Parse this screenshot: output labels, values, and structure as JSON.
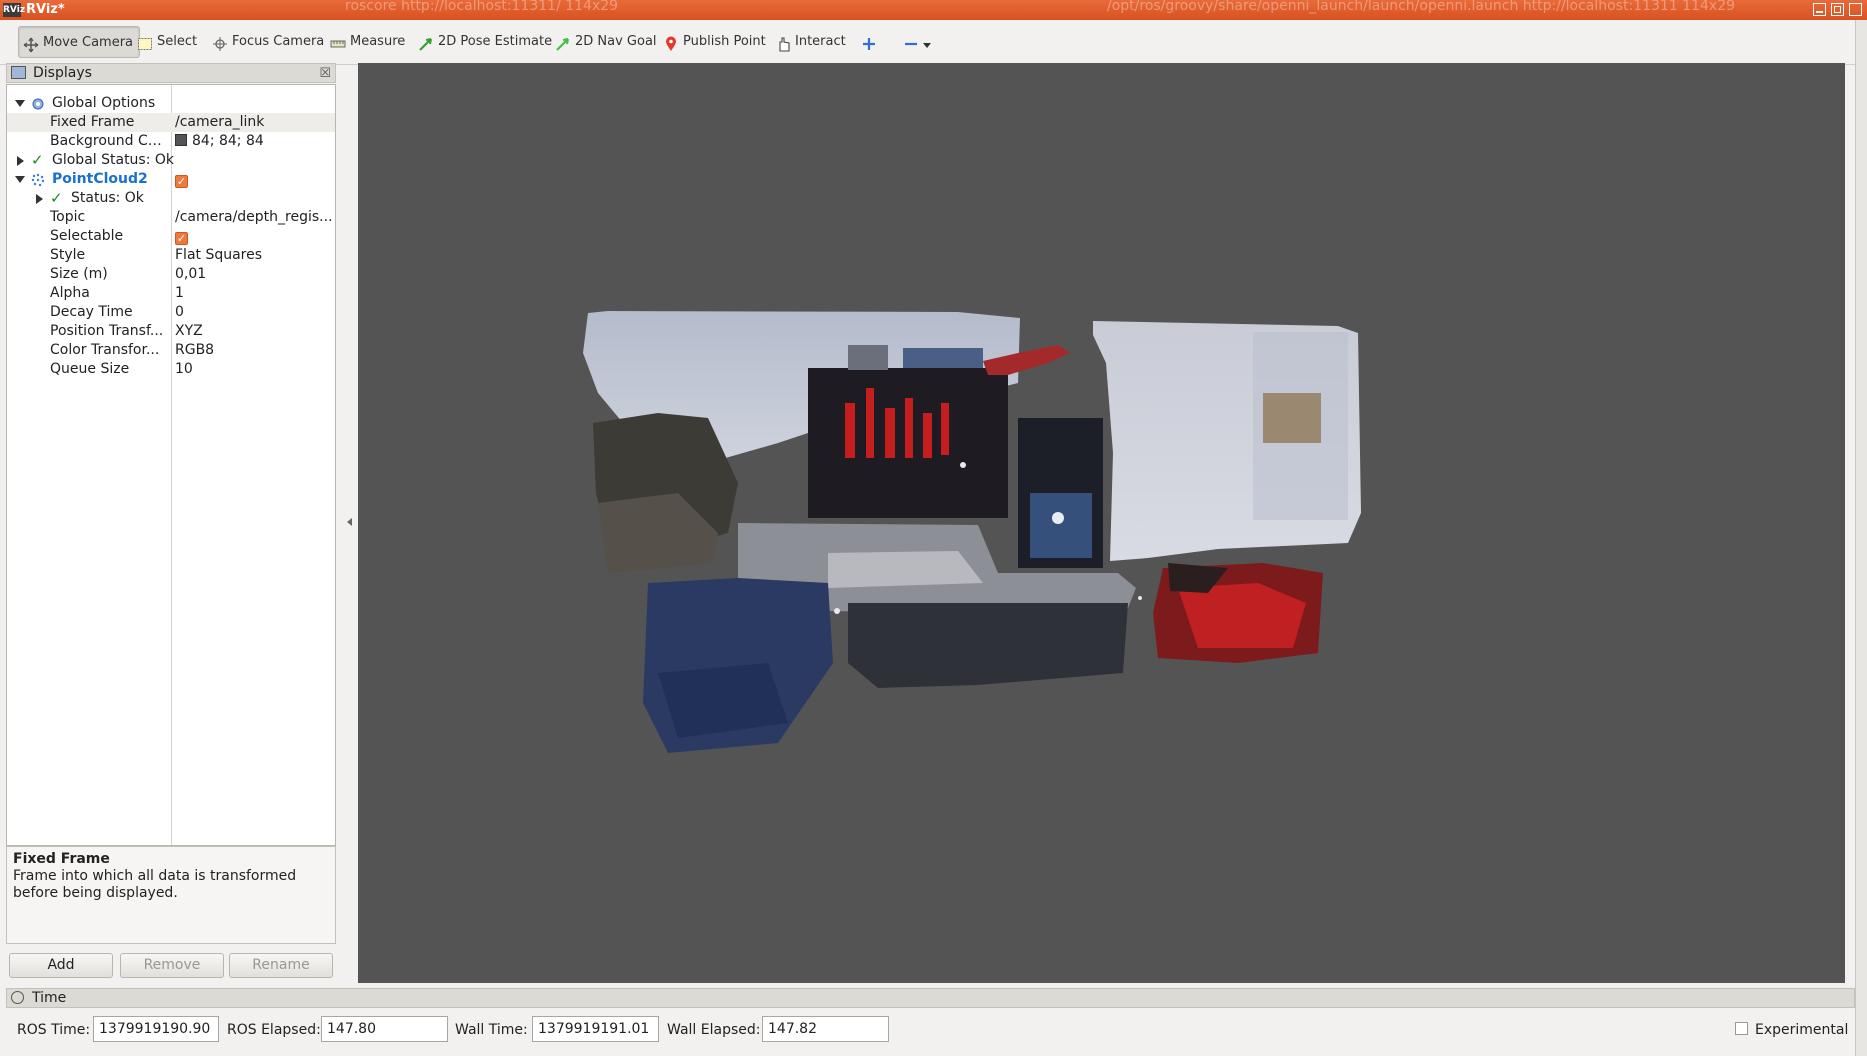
{
  "window": {
    "logo_text": "RViz",
    "title": "RViz*",
    "background_tabs": [
      "roscore http://localhost:11311/ 114x29",
      "/opt/ros/groovy/share/openni_launch/launch/openni.launch http://localhost:11311 114x29"
    ]
  },
  "toolbar": {
    "tools": [
      {
        "label": "Move Camera",
        "icon": "move-camera-icon",
        "active": true
      },
      {
        "label": "Select",
        "icon": "select-icon"
      },
      {
        "label": "Focus Camera",
        "icon": "focus-camera-icon"
      },
      {
        "label": "Measure",
        "icon": "measure-icon"
      },
      {
        "label": "2D Pose Estimate",
        "icon": "pose-estimate-icon"
      },
      {
        "label": "2D Nav Goal",
        "icon": "nav-goal-icon"
      },
      {
        "label": "Publish Point",
        "icon": "publish-point-icon"
      },
      {
        "label": "Interact",
        "icon": "interact-icon"
      }
    ],
    "add_tool_icon": "plus-icon",
    "remove_tool_icon": "minus-icon"
  },
  "displays": {
    "title": "Displays",
    "global_options": "Global Options",
    "fixed_frame": {
      "key": "Fixed Frame",
      "value": "/camera_link"
    },
    "background_color": {
      "key": "Background Co...",
      "value": "84; 84; 84",
      "color": "#545454"
    },
    "global_status": "Global Status: Ok",
    "pointcloud": {
      "name": "PointCloud2",
      "enabled": true,
      "status": "Status: Ok",
      "props": [
        {
          "key": "Topic",
          "value": "/camera/depth_regis..."
        },
        {
          "key": "Selectable",
          "checkbox": true
        },
        {
          "key": "Style",
          "value": "Flat Squares"
        },
        {
          "key": "Size (m)",
          "value": "0,01"
        },
        {
          "key": "Alpha",
          "value": "1"
        },
        {
          "key": "Decay Time",
          "value": "0"
        },
        {
          "key": "Position Transf...",
          "value": "XYZ"
        },
        {
          "key": "Color Transfor...",
          "value": "RGB8"
        },
        {
          "key": "Queue Size",
          "value": "10"
        }
      ]
    },
    "description": {
      "title": "Fixed Frame",
      "body": "Frame into which all data is transformed before being displayed."
    },
    "buttons": {
      "add": "Add",
      "remove": "Remove",
      "rename": "Rename"
    }
  },
  "time": {
    "title": "Time",
    "ros_time_label": "ROS Time:",
    "ros_time": "1379919190.90",
    "ros_elapsed_label": "ROS Elapsed:",
    "ros_elapsed": "147.80",
    "wall_time_label": "Wall Time:",
    "wall_time": "1379919191.01",
    "wall_elapsed_label": "Wall Elapsed:",
    "wall_elapsed": "147.82",
    "experimental_label": "Experimental",
    "experimental_checked": false
  },
  "colors": {
    "title_bar": "#d8521f",
    "view_background": "#545454",
    "accent_checkbox": "#f07a3c",
    "pointcloud_name": "#1a6fd1"
  }
}
